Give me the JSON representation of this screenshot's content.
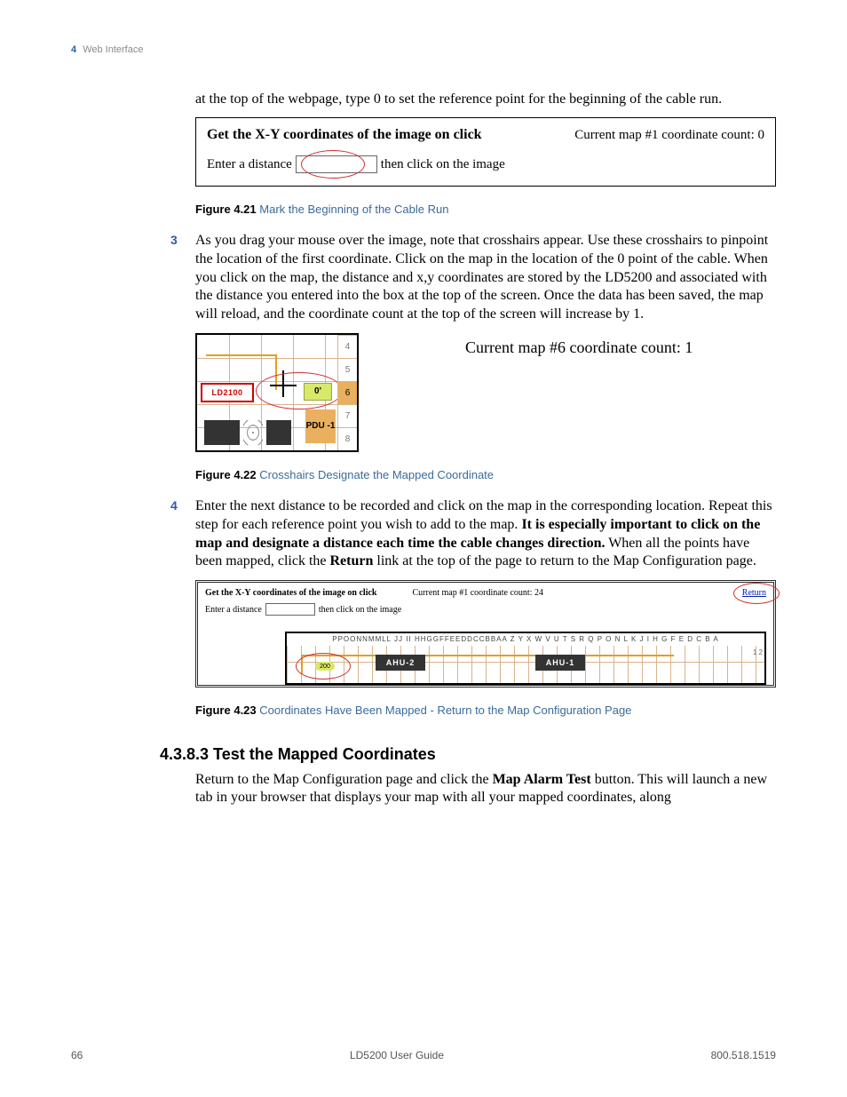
{
  "running_head": {
    "chapter_num": "4",
    "chapter_title": "Web Interface"
  },
  "intro_para": "at the top of the webpage, type 0 to set the reference point for the beginning of the cable run.",
  "fig21": {
    "get_xy": "Get the X-Y coordinates of the image on click",
    "count_text": "Current map #1 coordinate count: 0",
    "enter_distance_label": "Enter a distance",
    "then_click": "then click on the image",
    "caption_label": "Figure 4.21",
    "caption_title": "Mark the Beginning of the Cable Run"
  },
  "step3": {
    "num": "3",
    "text": "As you drag your mouse over the image, note that crosshairs appear. Use these crosshairs to pinpoint the location of the first coordinate. Click on the map in the location of the 0 point of the cable. When you click on the map, the distance and x,y coordinates are stored by the LD5200 and associated with the distance you entered into the box at the top of the screen. Once the data has been saved, the map will reload, and the coordinate count at the top of the screen will increase by 1."
  },
  "fig22": {
    "right_count": "Current map #6 coordinate count: 1",
    "ld_label": "LD2100",
    "zero_label": "0'",
    "pdu_label": "PDU\n-1",
    "edge_numbers": [
      "4",
      "5",
      "6",
      "7",
      "8"
    ],
    "caption_label": "Figure 4.22",
    "caption_title": "Crosshairs Designate the Mapped Coordinate"
  },
  "step4": {
    "num": "4",
    "t1": "Enter the next distance to be recorded and click on the map in the corresponding location. Repeat this step for each reference point you wish to add to the map. ",
    "bold1": "It is especially important to click on the map and designate a distance each time the cable changes direction.",
    "t2": " When all the points have been mapped, click the ",
    "bold2": "Return",
    "t3": " link at the top of the page to return to the Map Configuration page."
  },
  "fig23": {
    "get_xy": "Get the X-Y coordinates of the image on click",
    "count_text": "Current map #1 coordinate count: 24",
    "return_label": "Return",
    "enter_distance_label": "Enter a distance",
    "then_click": "then click on the image",
    "letters": "PPOONNMMLL JJ II HHGGFFEEDDCCBBAA Z Y X W V U T S R Q P O N L K J I H G F E D C B A",
    "ahu2": "AHU-2",
    "ahu1": "AHU-1",
    "badge": "200",
    "edge_numbers": "1\n2",
    "caption_label": "Figure 4.23",
    "caption_title": "Coordinates Have Been Mapped - Return to the Map Configuration Page"
  },
  "section_heading": "4.3.8.3 Test the Mapped Coordinates",
  "section_para_a": "Return to the Map Configuration page and click the ",
  "section_bold": "Map Alarm Test",
  "section_para_b": " button. This will launch a new tab in your browser that displays your map with all your mapped coordinates, along",
  "footer": {
    "page_num": "66",
    "doc_title": "LD5200 User Guide",
    "phone": "800.518.1519"
  }
}
